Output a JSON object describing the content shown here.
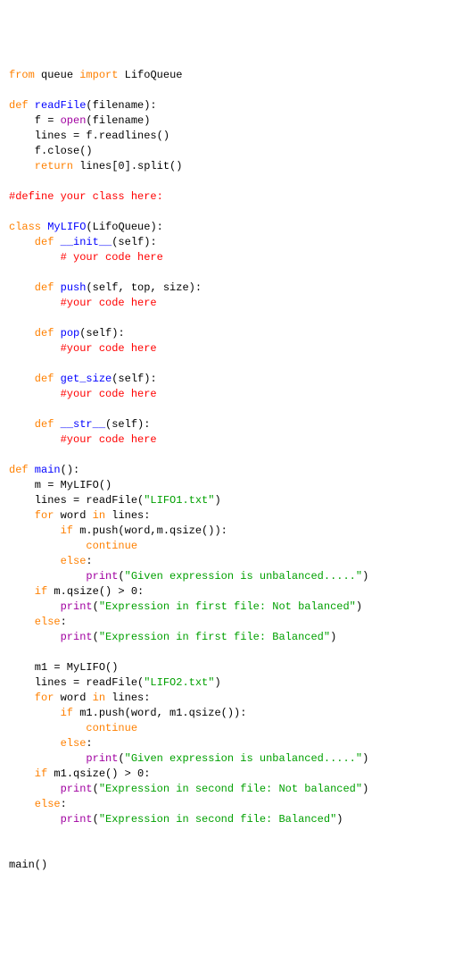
{
  "code": {
    "l1_from": "from",
    "l1_mod": " queue ",
    "l1_import": "import",
    "l1_name": " LifoQueue",
    "l3_def": "def",
    "l3_name": " readFile",
    "l3_rest": "(filename):",
    "l4a": "    f = ",
    "l4b": "open",
    "l4c": "(filename)",
    "l5": "    lines = f.readlines()",
    "l6": "    f.close()",
    "l7_ret": "    return",
    "l7_rest": " lines[0].split()",
    "l9_comment": "#define your class here:",
    "l11_class": "class",
    "l11_name": " MyLIFO",
    "l11_rest": "(LifoQueue):",
    "l12_def": "    def",
    "l12_name": " __init__",
    "l12_rest": "(self):",
    "l13_comment": "        # your code here",
    "l15_def": "    def",
    "l15_name": " push",
    "l15_rest": "(self, top, size):",
    "l16_comment": "        #your code here",
    "l18_def": "    def",
    "l18_name": " pop",
    "l18_rest": "(self):",
    "l19_comment": "        #your code here",
    "l21_def": "    def",
    "l21_name": " get_size",
    "l21_rest": "(self):",
    "l22_comment": "        #your code here",
    "l24_def": "    def",
    "l24_name": " __str__",
    "l24_rest": "(self):",
    "l25_comment": "        #your code here",
    "l27_def": "def",
    "l27_name": " main",
    "l27_rest": "():",
    "l28": "    m = MyLIFO()",
    "l29a": "    lines = readFile(",
    "l29b": "\"LIFO1.txt\"",
    "l29c": ")",
    "l30_for": "    for",
    "l30_mid": " word ",
    "l30_in": "in",
    "l30_rest": " lines:",
    "l31_if": "        if",
    "l31_rest": " m.push(word,m.qsize()):",
    "l32_cont": "            continue",
    "l33_else": "        else",
    "l33_colon": ":",
    "l34a": "            ",
    "l34b": "print",
    "l34c": "(",
    "l34d": "\"Given expression is unbalanced.....\"",
    "l34e": ")",
    "l35_if": "    if",
    "l35_rest": " m.qsize() > 0:",
    "l36a": "        ",
    "l36b": "print",
    "l36c": "(",
    "l36d": "\"Expression in first file: Not balanced\"",
    "l36e": ")",
    "l37_else": "    else",
    "l37_colon": ":",
    "l38a": "        ",
    "l38b": "print",
    "l38c": "(",
    "l38d": "\"Expression in first file: Balanced\"",
    "l38e": ")",
    "l40": "    m1 = MyLIFO()",
    "l41a": "    lines = readFile(",
    "l41b": "\"LIFO2.txt\"",
    "l41c": ")",
    "l42_for": "    for",
    "l42_mid": " word ",
    "l42_in": "in",
    "l42_rest": " lines:",
    "l43_if": "        if",
    "l43_rest": " m1.push(word, m1.qsize()):",
    "l44_cont": "            continue",
    "l45_else": "        else",
    "l45_colon": ":",
    "l46a": "            ",
    "l46b": "print",
    "l46c": "(",
    "l46d": "\"Given expression is unbalanced.....\"",
    "l46e": ")",
    "l47_if": "    if",
    "l47_rest": " m1.qsize() > 0:",
    "l48a": "        ",
    "l48b": "print",
    "l48c": "(",
    "l48d": "\"Expression in second file: Not balanced\"",
    "l48e": ")",
    "l49_else": "    else",
    "l49_colon": ":",
    "l50a": "        ",
    "l50b": "print",
    "l50c": "(",
    "l50d": "\"Expression in second file: Balanced\"",
    "l50e": ")",
    "l53": "main()"
  }
}
